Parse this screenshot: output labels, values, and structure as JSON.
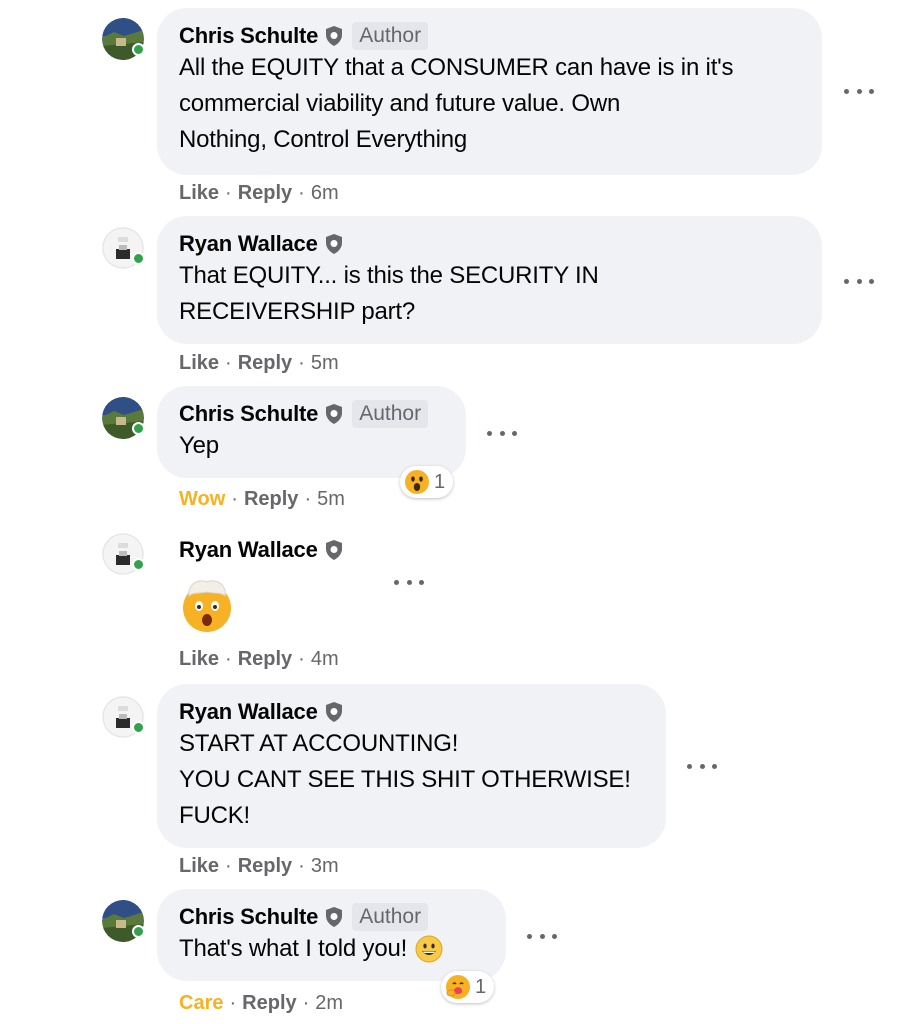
{
  "comments": [
    {
      "author": "Chris Schulte",
      "badge": "Author",
      "text": "All the EQUITY that a CONSUMER can have is in it's\ncommercial viability and future value. Own\nNothing, Control Everything",
      "like": "Like",
      "reply": "Reply",
      "time": "6m"
    },
    {
      "author": "Ryan Wallace",
      "text": "That EQUITY... is this the SECURITY IN\nRECEIVERSHIP part?",
      "like": "Like",
      "reply": "Reply",
      "time": "5m"
    },
    {
      "author": "Chris Schulte",
      "badge": "Author",
      "text": "Yep",
      "like": "Wow",
      "reply": "Reply",
      "time": "5m",
      "reaction_count": "1",
      "reaction_icon": "wow-emoji-icon"
    },
    {
      "author": "Ryan Wallace",
      "emoji": "exploding-head-emoji",
      "like": "Like",
      "reply": "Reply",
      "time": "4m"
    },
    {
      "author": "Ryan Wallace",
      "text": "START AT ACCOUNTING!\nYOU CANT SEE THIS SHIT OTHERWISE!\nFUCK!",
      "like": "Like",
      "reply": "Reply",
      "time": "3m"
    },
    {
      "author": "Chris Schulte",
      "badge": "Author",
      "text": "That's what I told you!",
      "trailing_emoji": "grinning-emoji",
      "like": "Care",
      "reply": "Reply",
      "time": "2m",
      "reaction_count": "1",
      "reaction_icon": "care-emoji-icon"
    }
  ],
  "colors": {
    "bubble": "#f0f2f5",
    "meta_text": "#65676b",
    "online": "#31a24c",
    "reaction_yellow": "#f7b125"
  }
}
